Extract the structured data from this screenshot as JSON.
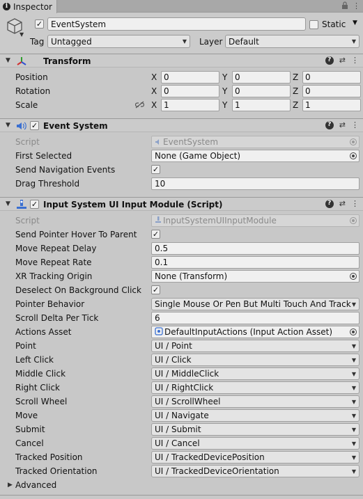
{
  "tab": {
    "title": "Inspector"
  },
  "gameobject": {
    "name": "EventSystem",
    "static_label": "Static",
    "tag_label": "Tag",
    "tag_value": "Untagged",
    "layer_label": "Layer",
    "layer_value": "Default"
  },
  "transform": {
    "title": "Transform",
    "rows": [
      {
        "label": "Position",
        "x": "0",
        "y": "0",
        "z": "0"
      },
      {
        "label": "Rotation",
        "x": "0",
        "y": "0",
        "z": "0"
      },
      {
        "label": "Scale",
        "x": "1",
        "y": "1",
        "z": "1"
      }
    ],
    "axis_x": "X",
    "axis_y": "Y",
    "axis_z": "Z"
  },
  "event_system": {
    "title": "Event System",
    "script_label": "Script",
    "script_value": "EventSystem",
    "first_selected_label": "First Selected",
    "first_selected_value": "None (Game Object)",
    "send_nav_label": "Send Navigation Events",
    "drag_threshold_label": "Drag Threshold",
    "drag_threshold_value": "10"
  },
  "input_module": {
    "title": "Input System UI Input Module (Script)",
    "script_label": "Script",
    "script_value": "InputSystemUIInputModule",
    "send_pointer_hover_label": "Send Pointer Hover To Parent",
    "move_repeat_delay_label": "Move Repeat Delay",
    "move_repeat_delay_value": "0.5",
    "move_repeat_rate_label": "Move Repeat Rate",
    "move_repeat_rate_value": "0.1",
    "xr_tracking_label": "XR Tracking Origin",
    "xr_tracking_value": "None (Transform)",
    "deselect_label": "Deselect On Background Click",
    "pointer_behavior_label": "Pointer Behavior",
    "pointer_behavior_value": "Single Mouse Or Pen But Multi Touch And Track",
    "scroll_delta_label": "Scroll Delta Per Tick",
    "scroll_delta_value": "6",
    "actions_asset_label": "Actions Asset",
    "actions_asset_value": "DefaultInputActions (Input Action Asset)",
    "actions": [
      {
        "label": "Point",
        "value": "UI / Point"
      },
      {
        "label": "Left Click",
        "value": "UI / Click"
      },
      {
        "label": "Middle Click",
        "value": "UI / MiddleClick"
      },
      {
        "label": "Right Click",
        "value": "UI / RightClick"
      },
      {
        "label": "Scroll Wheel",
        "value": "UI / ScrollWheel"
      },
      {
        "label": "Move",
        "value": "UI / Navigate"
      },
      {
        "label": "Submit",
        "value": "UI / Submit"
      },
      {
        "label": "Cancel",
        "value": "UI / Cancel"
      },
      {
        "label": "Tracked Position",
        "value": "UI / TrackedDevicePosition"
      },
      {
        "label": "Tracked Orientation",
        "value": "UI / TrackedDeviceOrientation"
      }
    ],
    "advanced_label": "Advanced"
  }
}
